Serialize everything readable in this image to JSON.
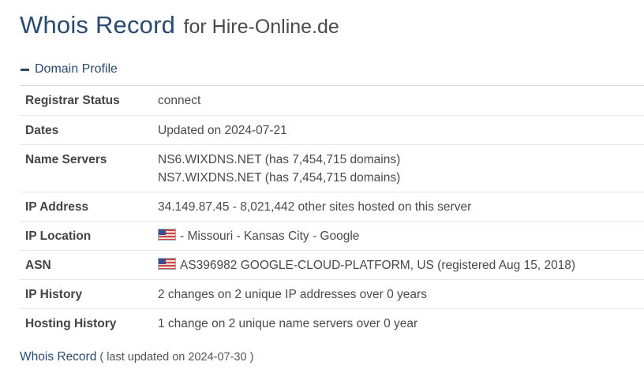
{
  "title": {
    "main": "Whois Record",
    "sub": "for Hire-Online.de"
  },
  "section": {
    "label": "Domain Profile",
    "icon": "minus-icon"
  },
  "profile": {
    "registrar_status": {
      "key": "Registrar Status",
      "value": "connect"
    },
    "dates": {
      "key": "Dates",
      "value": "Updated on 2024-07-21"
    },
    "name_servers": {
      "key": "Name Servers",
      "values": [
        "NS6.WIXDNS.NET (has 7,454,715 domains)",
        "NS7.WIXDNS.NET (has 7,454,715 domains)"
      ]
    },
    "ip_address": {
      "key": "IP Address",
      "value": "34.149.87.45 - 8,021,442 other sites hosted on this server"
    },
    "ip_location": {
      "key": "IP Location",
      "value": "- Missouri - Kansas City - Google",
      "flag": "us-flag-icon"
    },
    "asn": {
      "key": "ASN",
      "value": "AS396982 GOOGLE-CLOUD-PLATFORM, US (registered Aug 15, 2018)",
      "flag": "us-flag-icon"
    },
    "ip_history": {
      "key": "IP History",
      "value": "2 changes on 2 unique IP addresses over 0 years"
    },
    "hosting_history": {
      "key": "Hosting History",
      "value": "1 change on 2 unique name servers over 0 year"
    }
  },
  "footer": {
    "link": "Whois Record",
    "note": "( last updated on 2024-07-30 )"
  },
  "colors": {
    "accent": "#2b4a6f",
    "divider": "#e6e6e6"
  }
}
